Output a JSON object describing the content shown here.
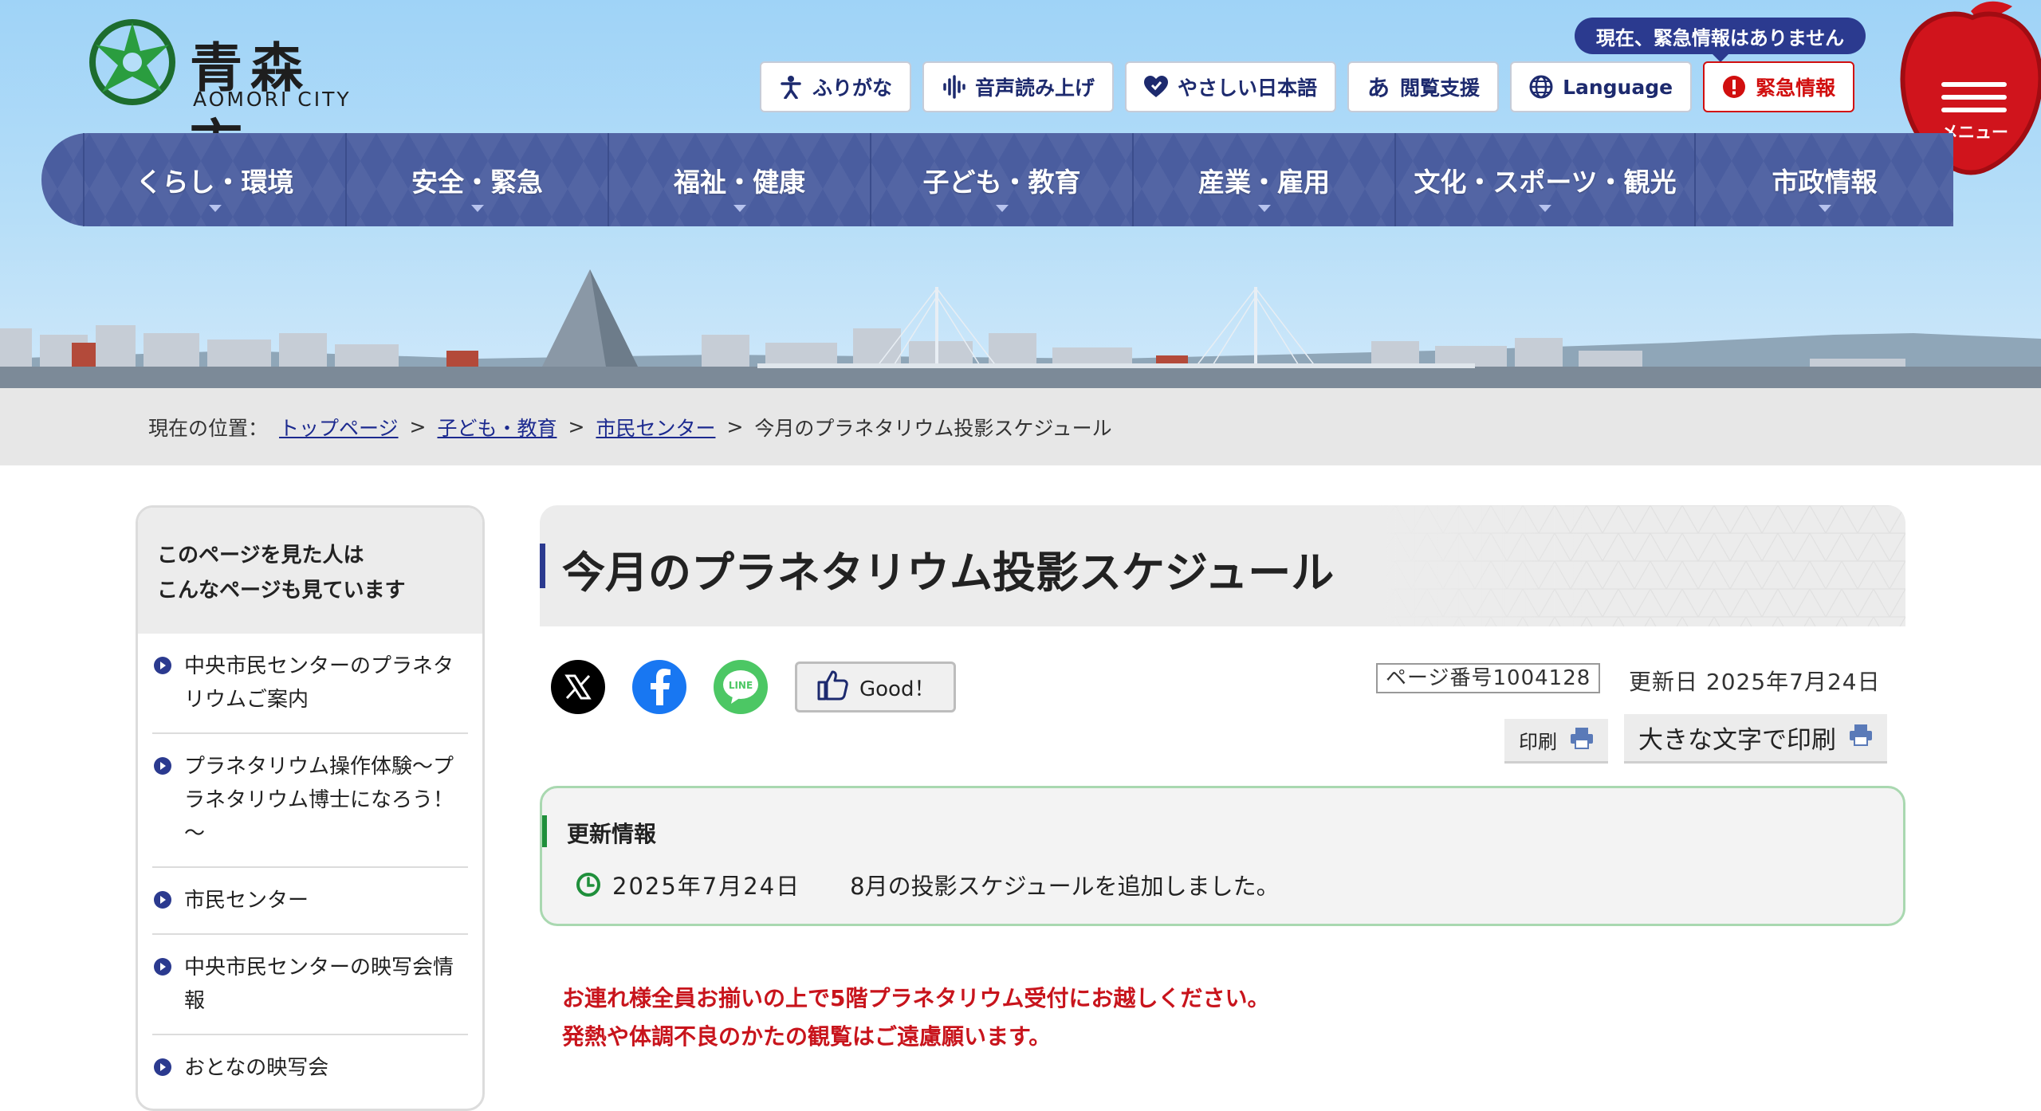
{
  "header": {
    "logo_ja": "青森市",
    "logo_en": "AOMORI CITY",
    "emergency_status": "現在、緊急情報はありません",
    "utility": [
      {
        "label": "ふりがな",
        "icon": "person-icon"
      },
      {
        "label": "音声読み上げ",
        "icon": "audio-wave-icon"
      },
      {
        "label": "やさしい日本語",
        "icon": "heart-icon"
      },
      {
        "label": "閲覧支援",
        "icon": "hiragana-a-icon"
      },
      {
        "label": "Language",
        "icon": "globe-icon"
      }
    ],
    "emergency_button": "緊急情報",
    "menu_label": "メニュー",
    "colors": {
      "nav": "#4a5d9f",
      "emergency": "#d10f0f",
      "apple": "#d0141c"
    }
  },
  "gnav": [
    {
      "label": "くらし・環境"
    },
    {
      "label": "安全・緊急"
    },
    {
      "label": "福祉・健康"
    },
    {
      "label": "子ども・教育"
    },
    {
      "label": "産業・雇用"
    },
    {
      "label": "文化・スポーツ・観光"
    },
    {
      "label": "市政情報"
    }
  ],
  "breadcrumb": {
    "prefix": "現在の位置：",
    "links": [
      "トップページ",
      "子ども・教育",
      "市民センター"
    ],
    "current": "今月のプラネタリウム投影スケジュール",
    "separator": ">"
  },
  "sidebar": {
    "heading_line1": "このページを見た人は",
    "heading_line2": "こんなページも見ています",
    "items": [
      "中央市民センターのプラネタリウムご案内",
      "プラネタリウム操作体験～プラネタリウム博士になろう！～",
      "市民センター",
      "中央市民センターの映写会情報",
      "おとなの映写会"
    ]
  },
  "main": {
    "title": "今月のプラネタリウム投影スケジュール",
    "share": [
      {
        "name": "x-share-icon",
        "color": "#000000"
      },
      {
        "name": "facebook-share-icon",
        "color": "#1877f2"
      },
      {
        "name": "line-share-icon",
        "color": "#4cc764"
      }
    ],
    "good_label": "Good！",
    "page_number": "ページ番号1004128",
    "updated": "更新日 2025年7月24日",
    "print_label": "印刷",
    "print_large_label": "大きな文字で印刷",
    "update_info": {
      "heading": "更新情報",
      "date": "2025年7月24日",
      "text": "8月の投影スケジュールを追加しました。"
    },
    "notice_lines": [
      "お連れ様全員お揃いの上で5階プラネタリウム受付にお越しください。",
      "発熱や体調不良のかたの観覧はご遠慮願います。"
    ]
  }
}
